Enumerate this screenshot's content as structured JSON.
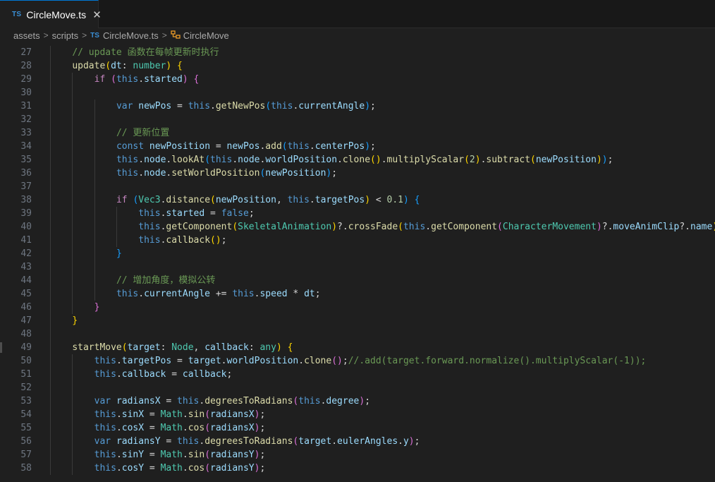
{
  "tab": {
    "icon": "TS",
    "label": "CircleMove.ts",
    "close": "✕"
  },
  "breadcrumb": {
    "assets": "assets",
    "scripts": "scripts",
    "ts_icon": "TS",
    "file": "CircleMove.ts",
    "class_icon": "class-icon",
    "class_name": "CircleMove"
  },
  "editor": {
    "language": "typescript",
    "lines": [
      {
        "n": "27",
        "indent": 1,
        "t": [
          [
            "cm",
            "// update 函数在每帧更新时执行"
          ]
        ]
      },
      {
        "n": "28",
        "indent": 1,
        "t": [
          [
            "fn",
            "update"
          ],
          [
            "b1",
            "("
          ],
          [
            "v",
            "dt"
          ],
          [
            "pl",
            ": "
          ],
          [
            "ty",
            "number"
          ],
          [
            "b1",
            ")"
          ],
          [
            "pl",
            " "
          ],
          [
            "b1",
            "{"
          ]
        ]
      },
      {
        "n": "29",
        "indent": 2,
        "t": [
          [
            "kc",
            "if"
          ],
          [
            "pl",
            " "
          ],
          [
            "b2",
            "("
          ],
          [
            "kw",
            "this"
          ],
          [
            "pl",
            "."
          ],
          [
            "v",
            "started"
          ],
          [
            "b2",
            ")"
          ],
          [
            "pl",
            " "
          ],
          [
            "b2",
            "{"
          ]
        ]
      },
      {
        "n": "30",
        "indent": 0,
        "t": []
      },
      {
        "n": "31",
        "indent": 3,
        "t": [
          [
            "kw",
            "var"
          ],
          [
            "pl",
            " "
          ],
          [
            "v",
            "newPos"
          ],
          [
            "pl",
            " = "
          ],
          [
            "kw",
            "this"
          ],
          [
            "pl",
            "."
          ],
          [
            "fn",
            "getNewPos"
          ],
          [
            "b3",
            "("
          ],
          [
            "kw",
            "this"
          ],
          [
            "pl",
            "."
          ],
          [
            "v",
            "currentAngle"
          ],
          [
            "b3",
            ")"
          ],
          [
            "pl",
            ";"
          ]
        ]
      },
      {
        "n": "32",
        "indent": 0,
        "t": []
      },
      {
        "n": "33",
        "indent": 3,
        "t": [
          [
            "cm",
            "// 更新位置"
          ]
        ]
      },
      {
        "n": "34",
        "indent": 3,
        "t": [
          [
            "kw",
            "const"
          ],
          [
            "pl",
            " "
          ],
          [
            "v",
            "newPosition"
          ],
          [
            "pl",
            " = "
          ],
          [
            "v",
            "newPos"
          ],
          [
            "pl",
            "."
          ],
          [
            "fn",
            "add"
          ],
          [
            "b3",
            "("
          ],
          [
            "kw",
            "this"
          ],
          [
            "pl",
            "."
          ],
          [
            "v",
            "centerPos"
          ],
          [
            "b3",
            ")"
          ],
          [
            "pl",
            ";"
          ]
        ]
      },
      {
        "n": "35",
        "indent": 3,
        "t": [
          [
            "kw",
            "this"
          ],
          [
            "pl",
            "."
          ],
          [
            "v",
            "node"
          ],
          [
            "pl",
            "."
          ],
          [
            "fn",
            "lookAt"
          ],
          [
            "b3",
            "("
          ],
          [
            "kw",
            "this"
          ],
          [
            "pl",
            "."
          ],
          [
            "v",
            "node"
          ],
          [
            "pl",
            "."
          ],
          [
            "v",
            "worldPosition"
          ],
          [
            "pl",
            "."
          ],
          [
            "fn",
            "clone"
          ],
          [
            "b1",
            "()"
          ],
          [
            "pl",
            "."
          ],
          [
            "fn",
            "multiplyScalar"
          ],
          [
            "b1",
            "("
          ],
          [
            "num",
            "2"
          ],
          [
            "b1",
            ")"
          ],
          [
            "pl",
            "."
          ],
          [
            "fn",
            "subtract"
          ],
          [
            "b1",
            "("
          ],
          [
            "v",
            "newPosition"
          ],
          [
            "b1",
            ")"
          ],
          [
            "b3",
            ")"
          ],
          [
            "pl",
            ";"
          ]
        ]
      },
      {
        "n": "36",
        "indent": 3,
        "t": [
          [
            "kw",
            "this"
          ],
          [
            "pl",
            "."
          ],
          [
            "v",
            "node"
          ],
          [
            "pl",
            "."
          ],
          [
            "fn",
            "setWorldPosition"
          ],
          [
            "b3",
            "("
          ],
          [
            "v",
            "newPosition"
          ],
          [
            "b3",
            ")"
          ],
          [
            "pl",
            ";"
          ]
        ]
      },
      {
        "n": "37",
        "indent": 0,
        "t": []
      },
      {
        "n": "38",
        "indent": 3,
        "t": [
          [
            "kc",
            "if"
          ],
          [
            "pl",
            " "
          ],
          [
            "b3",
            "("
          ],
          [
            "ty",
            "Vec3"
          ],
          [
            "pl",
            "."
          ],
          [
            "fn",
            "distance"
          ],
          [
            "b1",
            "("
          ],
          [
            "v",
            "newPosition"
          ],
          [
            "pl",
            ", "
          ],
          [
            "kw",
            "this"
          ],
          [
            "pl",
            "."
          ],
          [
            "v",
            "targetPos"
          ],
          [
            "b1",
            ")"
          ],
          [
            "pl",
            " < "
          ],
          [
            "num",
            "0.1"
          ],
          [
            "b3",
            ")"
          ],
          [
            "pl",
            " "
          ],
          [
            "b3",
            "{"
          ]
        ]
      },
      {
        "n": "39",
        "indent": 4,
        "t": [
          [
            "kw",
            "this"
          ],
          [
            "pl",
            "."
          ],
          [
            "v",
            "started"
          ],
          [
            "pl",
            " = "
          ],
          [
            "kw",
            "false"
          ],
          [
            "pl",
            ";"
          ]
        ]
      },
      {
        "n": "40",
        "indent": 4,
        "t": [
          [
            "kw",
            "this"
          ],
          [
            "pl",
            "."
          ],
          [
            "fn",
            "getComponent"
          ],
          [
            "b1",
            "("
          ],
          [
            "ty",
            "SkeletalAnimation"
          ],
          [
            "b1",
            ")"
          ],
          [
            "pl",
            "?."
          ],
          [
            "fn",
            "crossFade"
          ],
          [
            "b1",
            "("
          ],
          [
            "kw",
            "this"
          ],
          [
            "pl",
            "."
          ],
          [
            "fn",
            "getComponent"
          ],
          [
            "b2",
            "("
          ],
          [
            "ty",
            "CharacterMovement"
          ],
          [
            "b2",
            ")"
          ],
          [
            "pl",
            "?."
          ],
          [
            "v",
            "moveAnimClip"
          ],
          [
            "pl",
            "?."
          ],
          [
            "v",
            "name"
          ],
          [
            "b1",
            ")"
          ],
          [
            "pl",
            ";"
          ]
        ]
      },
      {
        "n": "41",
        "indent": 4,
        "t": [
          [
            "kw",
            "this"
          ],
          [
            "pl",
            "."
          ],
          [
            "fn",
            "callback"
          ],
          [
            "b1",
            "()"
          ],
          [
            "pl",
            ";"
          ]
        ]
      },
      {
        "n": "42",
        "indent": 3,
        "t": [
          [
            "b3",
            "}"
          ]
        ]
      },
      {
        "n": "43",
        "indent": 0,
        "t": []
      },
      {
        "n": "44",
        "indent": 3,
        "t": [
          [
            "cm",
            "// 增加角度，模拟公转"
          ]
        ]
      },
      {
        "n": "45",
        "indent": 3,
        "t": [
          [
            "kw",
            "this"
          ],
          [
            "pl",
            "."
          ],
          [
            "v",
            "currentAngle"
          ],
          [
            "pl",
            " += "
          ],
          [
            "kw",
            "this"
          ],
          [
            "pl",
            "."
          ],
          [
            "v",
            "speed"
          ],
          [
            "pl",
            " * "
          ],
          [
            "v",
            "dt"
          ],
          [
            "pl",
            ";"
          ]
        ]
      },
      {
        "n": "46",
        "indent": 2,
        "t": [
          [
            "b2",
            "}"
          ]
        ]
      },
      {
        "n": "47",
        "indent": 1,
        "t": [
          [
            "b1",
            "}"
          ]
        ]
      },
      {
        "n": "48",
        "indent": 0,
        "t": []
      },
      {
        "n": "49",
        "indent": 1,
        "t": [
          [
            "fn",
            "startMove"
          ],
          [
            "b1",
            "("
          ],
          [
            "v",
            "target"
          ],
          [
            "pl",
            ": "
          ],
          [
            "ty",
            "Node"
          ],
          [
            "pl",
            ", "
          ],
          [
            "v",
            "callback"
          ],
          [
            "pl",
            ": "
          ],
          [
            "ty",
            "any"
          ],
          [
            "b1",
            ")"
          ],
          [
            "pl",
            " "
          ],
          [
            "b1",
            "{"
          ]
        ]
      },
      {
        "n": "50",
        "indent": 2,
        "t": [
          [
            "kw",
            "this"
          ],
          [
            "pl",
            "."
          ],
          [
            "v",
            "targetPos"
          ],
          [
            "pl",
            " = "
          ],
          [
            "v",
            "target"
          ],
          [
            "pl",
            "."
          ],
          [
            "v",
            "worldPosition"
          ],
          [
            "pl",
            "."
          ],
          [
            "fn",
            "clone"
          ],
          [
            "b2",
            "()"
          ],
          [
            "pl",
            ";"
          ],
          [
            "cm",
            "//.add(target.forward.normalize().multiplyScalar(-1));"
          ]
        ]
      },
      {
        "n": "51",
        "indent": 2,
        "t": [
          [
            "kw",
            "this"
          ],
          [
            "pl",
            "."
          ],
          [
            "v",
            "callback"
          ],
          [
            "pl",
            " = "
          ],
          [
            "v",
            "callback"
          ],
          [
            "pl",
            ";"
          ]
        ]
      },
      {
        "n": "52",
        "indent": 0,
        "t": []
      },
      {
        "n": "53",
        "indent": 2,
        "t": [
          [
            "kw",
            "var"
          ],
          [
            "pl",
            " "
          ],
          [
            "v",
            "radiansX"
          ],
          [
            "pl",
            " = "
          ],
          [
            "kw",
            "this"
          ],
          [
            "pl",
            "."
          ],
          [
            "fn",
            "degreesToRadians"
          ],
          [
            "b2",
            "("
          ],
          [
            "kw",
            "this"
          ],
          [
            "pl",
            "."
          ],
          [
            "v",
            "degree"
          ],
          [
            "b2",
            ")"
          ],
          [
            "pl",
            ";"
          ]
        ]
      },
      {
        "n": "54",
        "indent": 2,
        "t": [
          [
            "kw",
            "this"
          ],
          [
            "pl",
            "."
          ],
          [
            "v",
            "sinX"
          ],
          [
            "pl",
            " = "
          ],
          [
            "ty",
            "Math"
          ],
          [
            "pl",
            "."
          ],
          [
            "fn",
            "sin"
          ],
          [
            "b2",
            "("
          ],
          [
            "v",
            "radiansX"
          ],
          [
            "b2",
            ")"
          ],
          [
            "pl",
            ";"
          ]
        ]
      },
      {
        "n": "55",
        "indent": 2,
        "t": [
          [
            "kw",
            "this"
          ],
          [
            "pl",
            "."
          ],
          [
            "v",
            "cosX"
          ],
          [
            "pl",
            " = "
          ],
          [
            "ty",
            "Math"
          ],
          [
            "pl",
            "."
          ],
          [
            "fn",
            "cos"
          ],
          [
            "b2",
            "("
          ],
          [
            "v",
            "radiansX"
          ],
          [
            "b2",
            ")"
          ],
          [
            "pl",
            ";"
          ]
        ]
      },
      {
        "n": "56",
        "indent": 2,
        "t": [
          [
            "kw",
            "var"
          ],
          [
            "pl",
            " "
          ],
          [
            "v",
            "radiansY"
          ],
          [
            "pl",
            " = "
          ],
          [
            "kw",
            "this"
          ],
          [
            "pl",
            "."
          ],
          [
            "fn",
            "degreesToRadians"
          ],
          [
            "b2",
            "("
          ],
          [
            "v",
            "target"
          ],
          [
            "pl",
            "."
          ],
          [
            "v",
            "eulerAngles"
          ],
          [
            "pl",
            "."
          ],
          [
            "v",
            "y"
          ],
          [
            "b2",
            ")"
          ],
          [
            "pl",
            ";"
          ]
        ]
      },
      {
        "n": "57",
        "indent": 2,
        "t": [
          [
            "kw",
            "this"
          ],
          [
            "pl",
            "."
          ],
          [
            "v",
            "sinY"
          ],
          [
            "pl",
            " = "
          ],
          [
            "ty",
            "Math"
          ],
          [
            "pl",
            "."
          ],
          [
            "fn",
            "sin"
          ],
          [
            "b2",
            "("
          ],
          [
            "v",
            "radiansY"
          ],
          [
            "b2",
            ")"
          ],
          [
            "pl",
            ";"
          ]
        ]
      },
      {
        "n": "58",
        "indent": 2,
        "t": [
          [
            "kw",
            "this"
          ],
          [
            "pl",
            "."
          ],
          [
            "v",
            "cosY"
          ],
          [
            "pl",
            " = "
          ],
          [
            "ty",
            "Math"
          ],
          [
            "pl",
            "."
          ],
          [
            "fn",
            "cos"
          ],
          [
            "b2",
            "("
          ],
          [
            "v",
            "radiansY"
          ],
          [
            "b2",
            ")"
          ],
          [
            "pl",
            ";"
          ]
        ]
      }
    ]
  }
}
